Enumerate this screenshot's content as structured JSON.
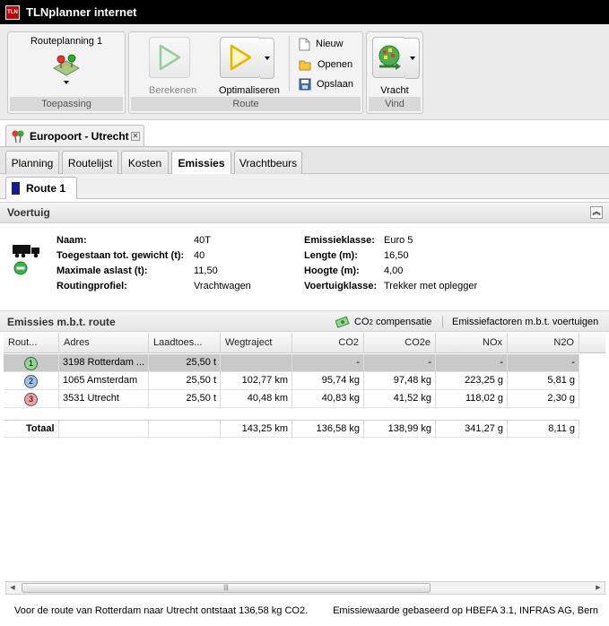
{
  "app": {
    "title": "TLNplanner internet",
    "logo_text": "TLN"
  },
  "ribbon": {
    "toepassing": {
      "group_label": "Toepassing",
      "routeplanning_label": "Routeplanning 1"
    },
    "route": {
      "group_label": "Route",
      "berekenen_label": "Berekenen",
      "optimaliseren_label": "Optimaliseren",
      "nieuw_label": "Nieuw",
      "openen_label": "Openen",
      "opslaan_label": "Opslaan"
    },
    "vind": {
      "group_label": "Vind",
      "vracht_label": "Vracht"
    }
  },
  "document_tab": {
    "label": "Europoort - Utrecht"
  },
  "tabs": [
    "Planning",
    "Routelijst",
    "Kosten",
    "Emissies",
    "Vrachtbeurs"
  ],
  "active_tab": "Emissies",
  "subtab": {
    "label": "Route 1",
    "color": "#1a1a8c"
  },
  "vehicle": {
    "section_title": "Voertuig",
    "left": [
      {
        "key": "Naam:",
        "value": "40T"
      },
      {
        "key": "Toegestaan tot. gewicht (t):",
        "value": "40"
      },
      {
        "key": "Maximale aslast (t):",
        "value": "11,50"
      },
      {
        "key": "Routingprofiel:",
        "value": "Vrachtwagen"
      }
    ],
    "right": [
      {
        "key": "Emissieklasse:",
        "value": "Euro 5"
      },
      {
        "key": "Lengte (m):",
        "value": "16,50"
      },
      {
        "key": "Hoogte (m):",
        "value": "4,00"
      },
      {
        "key": "Voertuigklasse:",
        "value": "Trekker met oplegger"
      }
    ]
  },
  "emissions": {
    "section_title": "Emissies m.b.t. route",
    "co2_btn_prefix": "CO",
    "co2_btn_sub": "2",
    "co2_btn_suffix": " compensatie",
    "factors_btn": "Emissiefactoren m.b.t. voertuigen",
    "columns": [
      "Rout...",
      "Adres",
      "Laadtoes...",
      "Wegtraject",
      "CO2",
      "CO2e",
      "NOx",
      "N2O"
    ],
    "rows": [
      {
        "badge": "1",
        "badge_color": "#8fd68f",
        "adres": "3198 Rotterdam ...",
        "laad": "25,50 t",
        "weg": "",
        "co2": "-",
        "co2e": "-",
        "nox": "-",
        "n2o": "-"
      },
      {
        "badge": "2",
        "badge_color": "#9cc4ea",
        "adres": "1065 Amsterdam",
        "laad": "25,50 t",
        "weg": "102,77 km",
        "co2": "95,74 kg",
        "co2e": "97,48 kg",
        "nox": "223,25 g",
        "n2o": "5,81 g"
      },
      {
        "badge": "3",
        "badge_color": "#f0a0a0",
        "adres": "3531 Utrecht",
        "laad": "25,50 t",
        "weg": "40,48 km",
        "co2": "40,83 kg",
        "co2e": "41,52 kg",
        "nox": "118,02 g",
        "n2o": "2,30 g"
      }
    ],
    "total": {
      "label": "Totaal",
      "weg": "143,25 km",
      "co2": "136,58 kg",
      "co2e": "138,99 kg",
      "nox": "341,27 g",
      "n2o": "8,11 g"
    }
  },
  "footer": {
    "left": "Voor de route van Rotterdam naar Utrecht ontstaat 136,58 kg CO2.",
    "right": "Emissiewaarde gebaseerd op HBEFA 3.1, INFRAS AG, Bern"
  }
}
